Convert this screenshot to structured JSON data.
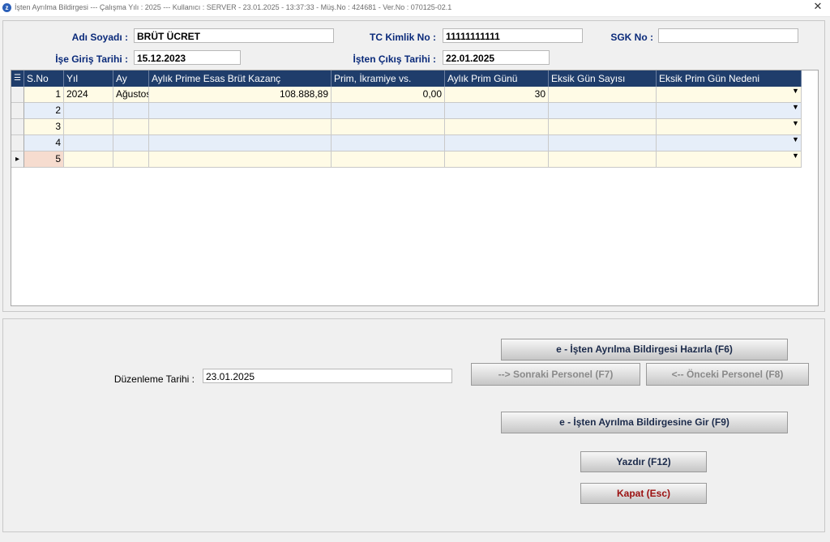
{
  "window": {
    "title": "İşten Ayrılma Bildirgesi  ---  Çalışma Yılı : 2025  ---  Kullanıcı : SERVER - 23.01.2025 - 13:37:33 - Müş.No : 424681 - Ver.No : 070125-02.1",
    "close_glyph": "✕",
    "app_icon_glyph": "z"
  },
  "form": {
    "ad_soyad_label": "Adı Soyadı :",
    "ad_soyad_value": "BRÜT ÜCRET",
    "tc_label": "TC Kimlik No :",
    "tc_value": "11111111111",
    "sgk_label": "SGK No :",
    "sgk_value": "",
    "giris_label": "İşe Giriş Tarihi :",
    "giris_value": "15.12.2023",
    "cikis_label": "İşten Çıkış Tarihi :",
    "cikis_value": "22.01.2025"
  },
  "grid": {
    "headers": [
      "S.No",
      "Yıl",
      "Ay",
      "Aylık Prime Esas Brüt Kazanç",
      "Prim, İkramiye vs.",
      "Aylık Prim Günü",
      "Eksik Gün Sayısı",
      "Eksik Prim Gün Nedeni"
    ],
    "rows": [
      {
        "sno": "1",
        "yil": "2024",
        "ay": "Ağustos",
        "kazanc": "108.888,89",
        "prim": "0,00",
        "gun": "30",
        "eksik": "",
        "neden": ""
      },
      {
        "sno": "2",
        "yil": "",
        "ay": "",
        "kazanc": "",
        "prim": "",
        "gun": "",
        "eksik": "",
        "neden": ""
      },
      {
        "sno": "3",
        "yil": "",
        "ay": "",
        "kazanc": "",
        "prim": "",
        "gun": "",
        "eksik": "",
        "neden": ""
      },
      {
        "sno": "4",
        "yil": "",
        "ay": "",
        "kazanc": "",
        "prim": "",
        "gun": "",
        "eksik": "",
        "neden": ""
      },
      {
        "sno": "5",
        "yil": "",
        "ay": "",
        "kazanc": "",
        "prim": "",
        "gun": "",
        "eksik": "",
        "neden": ""
      }
    ],
    "current_row_marker": "▸",
    "dropdown_glyph": "▼",
    "colors": {
      "header_bg": "#1f3d6b",
      "row_odd": "#fffbe6",
      "row_even": "#e6eef9",
      "current_sno": "#f6dccf"
    }
  },
  "bottom": {
    "duzenleme_label": "Düzenleme Tarihi :",
    "duzenleme_value": "23.01.2025",
    "btn_hazirla": "e - İşten Ayrılma Bildirgesi Hazırla (F6)",
    "btn_sonraki": "--> Sonraki Personel (F7)",
    "btn_onceki": "<-- Önceki Personel (F8)",
    "btn_gir": "e - İşten Ayrılma Bildirgesine Gir (F9)",
    "btn_yazdir": "Yazdır (F12)",
    "btn_kapat": "Kapat (Esc)"
  }
}
